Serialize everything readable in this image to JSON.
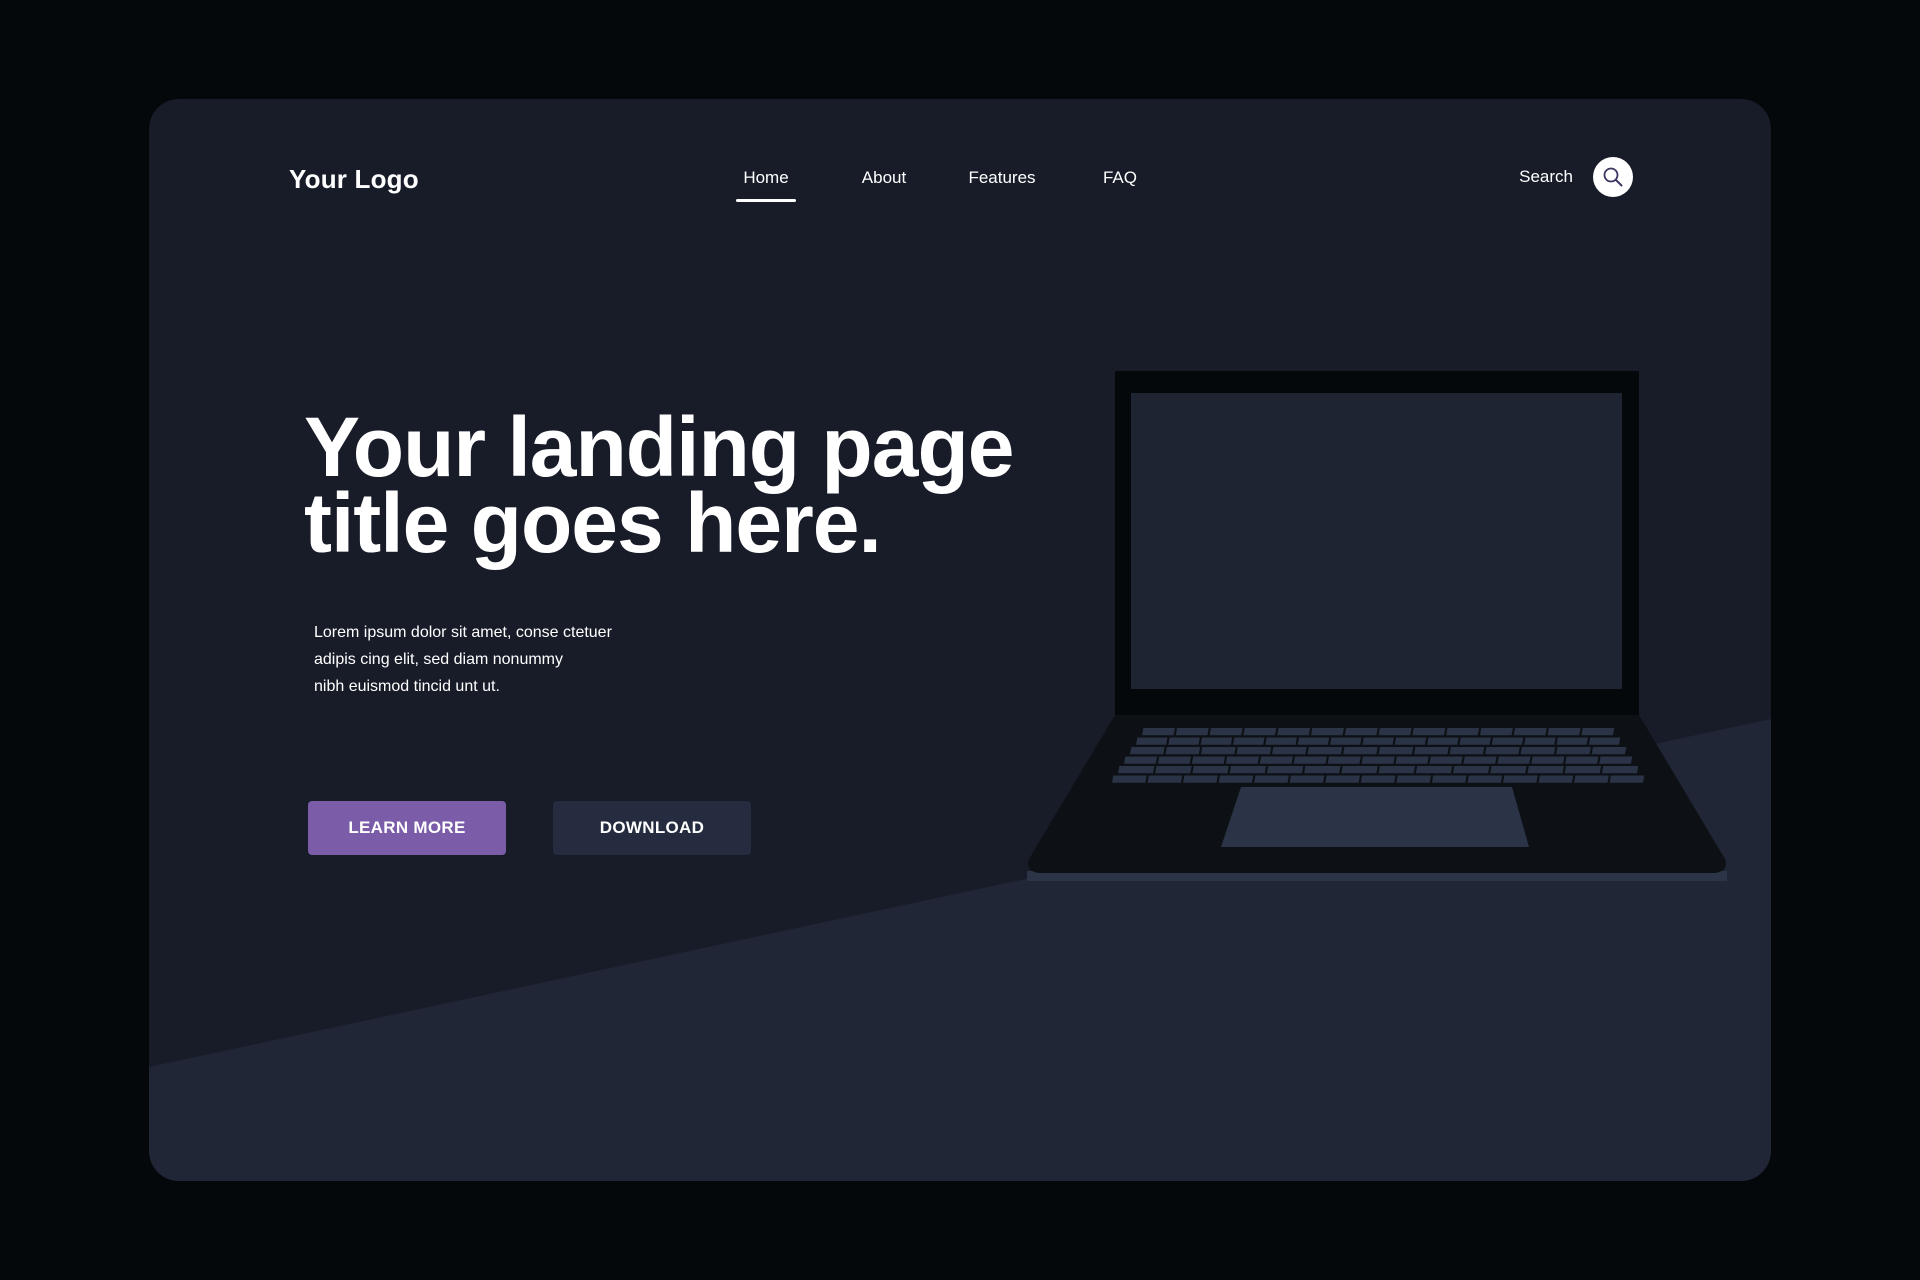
{
  "page": {
    "background": "#05080a",
    "card_background": "#181c29",
    "floor_color": "#202636"
  },
  "header": {
    "logo": "Your Logo",
    "nav": [
      {
        "label": "Home",
        "active": true
      },
      {
        "label": "About",
        "active": false
      },
      {
        "label": "Features",
        "active": false
      },
      {
        "label": "FAQ",
        "active": false
      }
    ],
    "search_label": "Search",
    "search_icon": "search-icon"
  },
  "hero": {
    "title_line1": "Your landing page",
    "title_line2": "title goes here.",
    "subtitle_line1": "Lorem ipsum dolor sit amet, conse ctetuer",
    "subtitle_line2": "adipis cing elit, sed diam nonummy",
    "subtitle_line3": "nibh euismod tincid unt ut."
  },
  "buttons": {
    "primary_label": "LEARN MORE",
    "primary_color": "#7a5ca9",
    "secondary_label": "DOWNLOAD",
    "secondary_color": "#252c40"
  },
  "illustration": {
    "name": "laptop",
    "screen_color": "#1f2433",
    "body_color": "#0d1014",
    "key_color": "#2b3346"
  }
}
